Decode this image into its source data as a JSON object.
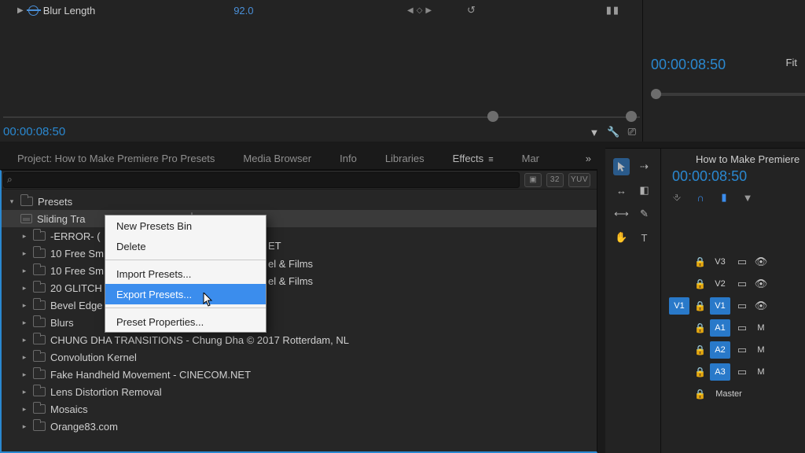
{
  "effect_controls": {
    "param_label": "Blur Length",
    "param_value": "92.0",
    "timecode": "00:00:08:50"
  },
  "program": {
    "timecode": "00:00:08:50",
    "zoom_label": "Fit"
  },
  "tabs": {
    "project": "Project: How to Make Premiere Pro Presets",
    "media": "Media Browser",
    "info": "Info",
    "libraries": "Libraries",
    "effects": "Effects",
    "markers": "Mar"
  },
  "search": {
    "chip_32": "32",
    "chip_yuv": "YUV"
  },
  "tree": {
    "root": "Presets",
    "selected": "Sliding Tra",
    "items": [
      "-ERROR- (",
      "10 Free Sm",
      "10 Free Sm",
      "20 GLITCH",
      "Bevel Edge",
      "Blurs",
      "CHUNG DHA TRANSITIONS - Chung Dha © 2017 Rotterdam, NL",
      "Convolution Kernel",
      "Fake Handheld Movement - CINECOM.NET",
      "Lens Distortion Removal",
      "Mosaics",
      "Orange83.com"
    ],
    "peek_right": [
      "ET",
      "el & Films",
      "el & Films"
    ]
  },
  "context_menu": {
    "new_bin": "New Presets Bin",
    "delete": "Delete",
    "import": "Import Presets...",
    "export": "Export Presets...",
    "properties": "Preset Properties..."
  },
  "timeline": {
    "title": "How to Make Premiere",
    "timecode": "00:00:08:50",
    "tracks": {
      "v3": "V3",
      "v2": "V2",
      "v1_src": "V1",
      "v1": "V1",
      "a1": "A1",
      "a2": "A2",
      "a3": "A3",
      "master": "Master"
    },
    "mute": "M"
  }
}
